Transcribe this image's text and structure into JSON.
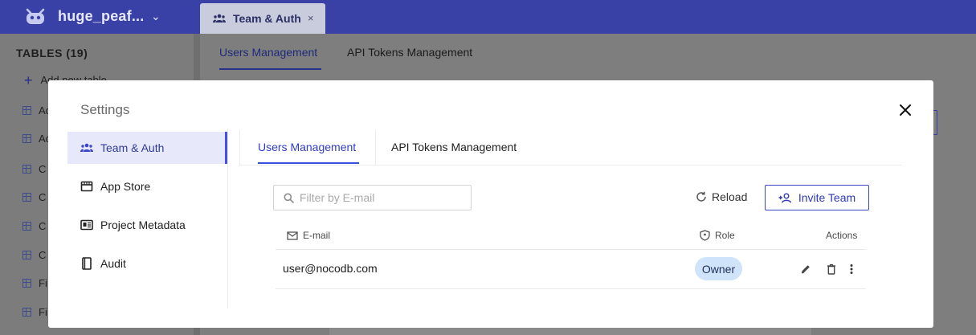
{
  "app": {
    "project_name": "huge_peaf...",
    "open_tab": "Team & Auth",
    "tab_close": "×"
  },
  "background": {
    "subtabs": [
      "Users Management",
      "API Tokens Management"
    ],
    "tables_heading": "TABLES (19)",
    "add_table": "Add new table",
    "table_items": [
      "Ac",
      "Ac",
      "C",
      "C",
      "C",
      "C",
      "Fi",
      "Fi"
    ]
  },
  "modal": {
    "title": "Settings",
    "nav": [
      {
        "label": "Team & Auth",
        "icon": "team-icon",
        "active": true
      },
      {
        "label": "App Store",
        "icon": "store-icon",
        "active": false
      },
      {
        "label": "Project Metadata",
        "icon": "metadata-icon",
        "active": false
      },
      {
        "label": "Audit",
        "icon": "audit-icon",
        "active": false
      }
    ],
    "tabs": [
      {
        "label": "Users Management",
        "active": true
      },
      {
        "label": "API Tokens Management",
        "active": false
      }
    ],
    "filter": {
      "placeholder": "Filter by E-mail",
      "value": ""
    },
    "reload_label": "Reload",
    "invite_label": "Invite Team",
    "table": {
      "columns": {
        "email": "E-mail",
        "role": "Role",
        "actions": "Actions"
      },
      "rows": [
        {
          "email": "user@nocodb.com",
          "role": "Owner"
        }
      ]
    }
  },
  "colors": {
    "brand": "#3940a6",
    "accent": "#3a4ee0",
    "badge": "#cfe3fb",
    "nav_active_bg": "#e7e9fb"
  }
}
